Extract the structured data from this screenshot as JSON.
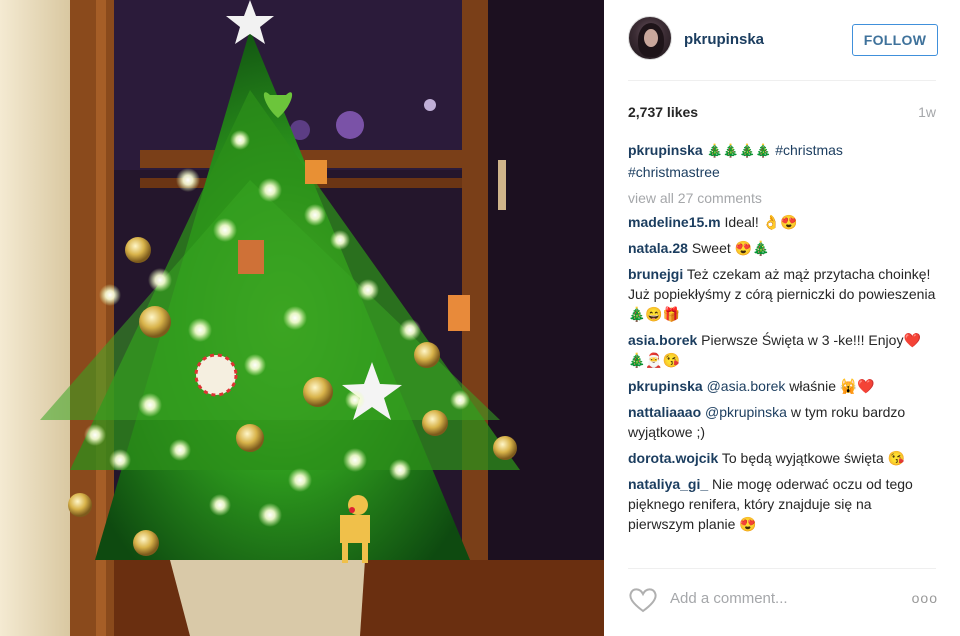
{
  "post": {
    "username": "pkrupinska",
    "follow_label": "FOLLOW",
    "likes": "2,737 likes",
    "age": "1w",
    "caption": {
      "user": "pkrupinska",
      "emojis": "🎄🎄🎄🎄",
      "tags": "#christmas #christmastree"
    },
    "view_all": "view all 27 comments",
    "comments": [
      {
        "user": "madeline15.m",
        "text": "Ideal! 👌😍"
      },
      {
        "user": "natala.28",
        "text": "Sweet 😍🎄"
      },
      {
        "user": "brunejgi",
        "text": "Też czekam aż mąż przytacha choinkę! Już popiekłyśmy z córą pierniczki do powieszenia 🎄😄🎁"
      },
      {
        "user": "asia.borek",
        "text": "Pierwsze Święta w 3 -ke!!! Enjoy❤️🎄🎅😘"
      },
      {
        "user": "pkrupinska",
        "mention": "@asia.borek",
        "text": "właśnie 🙀❤️"
      },
      {
        "user": "nattaliaaao",
        "mention": "@pkrupinska",
        "text": "w tym roku bardzo wyjątkowe ;)"
      },
      {
        "user": "dorota.wojcik",
        "text": "To będą wyjątkowe święta 😘"
      },
      {
        "user": "nataliya_gi_",
        "text": "Nie mogę oderwać oczu od tego pięknego renifera, który znajduje się na pierwszym planie 😍"
      }
    ],
    "add_comment_placeholder": "Add a comment...",
    "more_label": "ooo"
  },
  "icons": {
    "like": "heart-outline-icon",
    "more": "more-options-icon"
  },
  "colors": {
    "username": "#1b3d5f",
    "follow_border": "#4090db",
    "muted": "#a5a7aa"
  }
}
